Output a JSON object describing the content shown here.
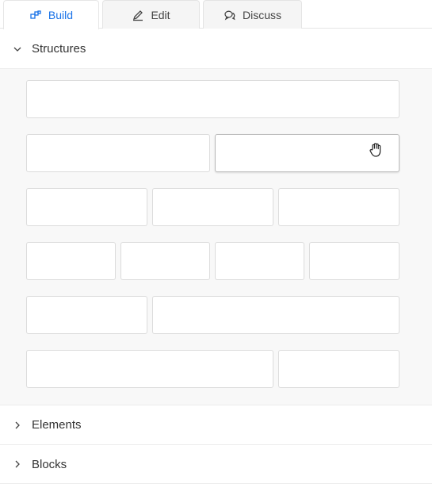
{
  "tabs": [
    {
      "label": "Build",
      "icon": "build-icon",
      "active": true
    },
    {
      "label": "Edit",
      "icon": "pencil-icon",
      "active": false
    },
    {
      "label": "Discuss",
      "icon": "chat-bubbles-icon",
      "active": false
    }
  ],
  "sections": {
    "structures": {
      "label": "Structures",
      "expanded": true
    },
    "elements": {
      "label": "Elements",
      "expanded": false
    },
    "blocks": {
      "label": "Blocks",
      "expanded": false
    }
  },
  "structures": {
    "rows": [
      {
        "layout": "1 column"
      },
      {
        "layout": "2 columns"
      },
      {
        "layout": "3 columns"
      },
      {
        "layout": "4 columns"
      },
      {
        "layout": "1/3 + 2/3"
      },
      {
        "layout": "2/3 + 1/3"
      }
    ]
  },
  "colors": {
    "accent": "#1a73e8",
    "panel_bg": "#f8f8f8",
    "border": "#dcdcdc"
  }
}
